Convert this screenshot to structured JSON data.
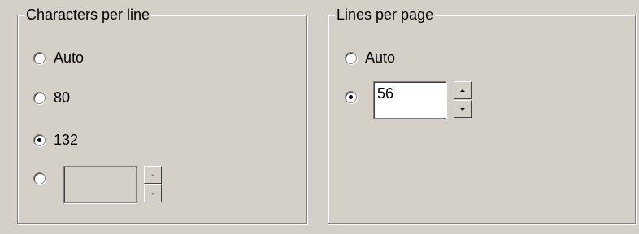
{
  "characters_per_line": {
    "legend": "Characters per line",
    "options": [
      {
        "label": "Auto",
        "selected": false
      },
      {
        "label": "80",
        "selected": false
      },
      {
        "label": "132",
        "selected": true
      },
      {
        "label": "",
        "selected": false,
        "custom": true,
        "value": "",
        "enabled": false
      }
    ]
  },
  "lines_per_page": {
    "legend": "Lines per page",
    "options": [
      {
        "label": "Auto",
        "selected": false
      },
      {
        "label": "",
        "selected": true,
        "custom": true,
        "value": "56",
        "enabled": true
      }
    ]
  },
  "colors": {
    "face": "#d4d0c8",
    "shadow": "#808080",
    "highlight": "#ffffff"
  }
}
